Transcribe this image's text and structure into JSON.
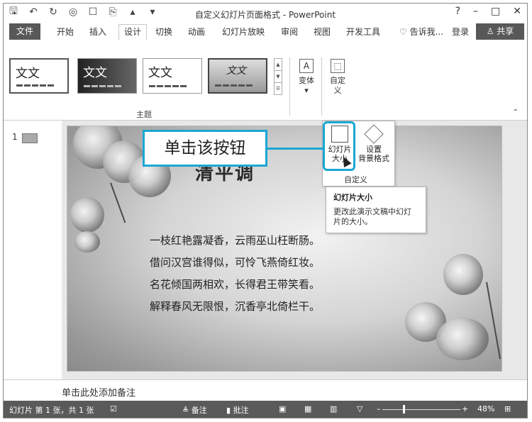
{
  "window": {
    "title": "自定义幻灯片页面格式 - PowerPoint",
    "controls": [
      "?",
      "–",
      "□",
      "✕"
    ]
  },
  "tabs": {
    "file": "文件",
    "items": [
      "开始",
      "插入",
      "设计",
      "切换",
      "动画",
      "幻灯片放映",
      "审阅",
      "视图",
      "开发工具"
    ],
    "active": "设计",
    "tell_me": "告诉我...",
    "login": "登录",
    "share": "共享"
  },
  "ribbon": {
    "themes": [
      "文文",
      "文文",
      "文文",
      "文文"
    ],
    "themes_group_label": "主题",
    "variants_label": "变体",
    "customize_label": "自定\n义",
    "customize_group_label": "自定义"
  },
  "dropdown": {
    "slide_size_label": "幻灯片\n大小",
    "format_bg_label": "设置\n背景格式",
    "group_label": "自定义"
  },
  "tooltip": {
    "title": "幻灯片大小",
    "desc": "更改此演示文稿中幻灯片的大小。"
  },
  "callout": {
    "text": "单击该按钮"
  },
  "slide": {
    "number": "1",
    "title": "清平调",
    "poem": [
      "一枝红艳露凝香，云雨巫山枉断肠。",
      "借问汉宫谁得似，可怜飞燕倚红妆。",
      "名花倾国两相欢，长得君王带笑看。",
      "解释春风无限恨，沉香亭北倚栏干。"
    ]
  },
  "notes": {
    "placeholder": "单击此处添加备注"
  },
  "statusbar": {
    "slide_info": "幻灯片 第 1 张，共 1 张",
    "notes": "备注",
    "comments": "批注",
    "zoom": "48%"
  },
  "colors": {
    "accent": "#1aa7d3",
    "file_tab": "#585858",
    "status_bg": "#5a5a5a"
  }
}
